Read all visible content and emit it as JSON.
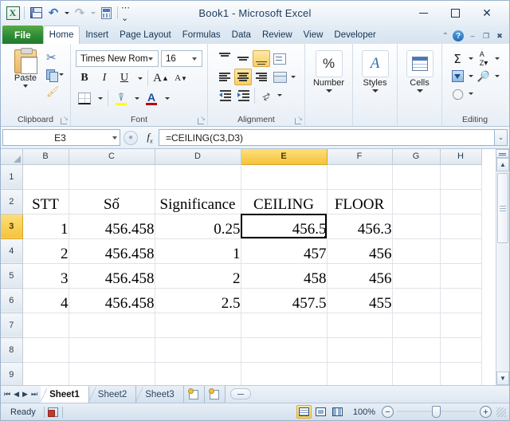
{
  "window": {
    "title": "Book1  -  Microsoft Excel",
    "minimize_label": "–",
    "maximize_label": "□",
    "close_label": "✕"
  },
  "quick_access": {
    "logo_label": "X",
    "items": [
      {
        "name": "save",
        "label": "Save"
      },
      {
        "name": "undo",
        "label": "Undo",
        "glyph": "↶"
      },
      {
        "name": "redo",
        "label": "Redo",
        "glyph": "↷"
      },
      {
        "name": "calculator",
        "label": "Calculator"
      },
      {
        "name": "customize",
        "label": "Customize Quick Access Toolbar",
        "glyph": "⌵"
      }
    ]
  },
  "ribbon": {
    "file_tab": "File",
    "tabs": [
      {
        "label": "Home",
        "active": true
      },
      {
        "label": "Insert",
        "active": false
      },
      {
        "label": "Page Layout",
        "active": false
      },
      {
        "label": "Formulas",
        "active": false
      },
      {
        "label": "Data",
        "active": false
      },
      {
        "label": "Review",
        "active": false
      },
      {
        "label": "View",
        "active": false
      },
      {
        "label": "Developer",
        "active": false
      }
    ],
    "collapse_glyph": "⌃",
    "help_label": "?",
    "restore_glyphs": [
      "–",
      "❐",
      "✖"
    ],
    "groups": {
      "clipboard": {
        "label": "Clipboard",
        "paste_label": "Paste",
        "cut_label": "Cut",
        "copy_label": "Copy",
        "format_painter_label": "Format Painter"
      },
      "font": {
        "label": "Font",
        "font_name": "Times New Rom",
        "font_size": "16",
        "bold_label": "B",
        "italic_label": "I",
        "underline_label": "U",
        "grow_label": "A",
        "shrink_label": "A",
        "borders_label": "Borders",
        "fill_color_label": "Fill Color",
        "font_color_label": "A",
        "fill_color": "#ffff00",
        "font_color": "#c00000"
      },
      "alignment": {
        "label": "Alignment",
        "top_align_label": "Top Align",
        "middle_align_label": "Middle Align",
        "bottom_align_label": "Bottom Align",
        "align_left_label": "Align Text Left",
        "center_label": "Center",
        "align_right_label": "Align Text Right",
        "wrap_text_label": "Wrap Text",
        "merge_label": "Merge & Center",
        "decrease_indent_label": "Decrease Indent",
        "increase_indent_label": "Increase Indent",
        "orientation_label": "Orientation",
        "active_buttons": [
          "Bottom Align",
          "Center"
        ]
      },
      "number": {
        "label": "Number",
        "button_label": "%"
      },
      "styles": {
        "label": "Styles",
        "button_label": "A"
      },
      "cells": {
        "label": "Cells"
      },
      "editing": {
        "label": "Editing",
        "autosum_label": "Σ",
        "sort_filter_label": "Sort & Filter",
        "fill_label": "Fill",
        "find_label": "Find & Select",
        "clear_label": "Clear"
      }
    }
  },
  "formula_bar": {
    "name_box_value": "E3",
    "fx_label": "fx",
    "formula": "=CEILING(C3,D3)",
    "expand_glyph": "⌄"
  },
  "grid": {
    "columns": [
      "B",
      "C",
      "D",
      "E",
      "F",
      "G",
      "H"
    ],
    "selected_column": "E",
    "rows": [
      "1",
      "2",
      "3",
      "4",
      "5",
      "6",
      "7",
      "8",
      "9"
    ],
    "selected_row": "3",
    "active_cell": "E3",
    "data": [
      {
        "row": "1",
        "cells": [
          "",
          "",
          "",
          "",
          "",
          "",
          ""
        ]
      },
      {
        "row": "2",
        "cells": [
          "STT",
          "Số",
          "Significance",
          "CEILING",
          "FLOOR",
          "",
          ""
        ]
      },
      {
        "row": "3",
        "cells": [
          "1",
          "456.458",
          "0.25",
          "456.5",
          "456.3",
          "",
          ""
        ]
      },
      {
        "row": "4",
        "cells": [
          "2",
          "456.458",
          "1",
          "457",
          "456",
          "",
          ""
        ]
      },
      {
        "row": "5",
        "cells": [
          "3",
          "456.458",
          "2",
          "458",
          "456",
          "",
          ""
        ]
      },
      {
        "row": "6",
        "cells": [
          "4",
          "456.458",
          "2.5",
          "457.5",
          "455",
          "",
          ""
        ]
      },
      {
        "row": "7",
        "cells": [
          "",
          "",
          "",
          "",
          "",
          "",
          ""
        ]
      },
      {
        "row": "8",
        "cells": [
          "",
          "",
          "",
          "",
          "",
          "",
          ""
        ]
      },
      {
        "row": "9",
        "cells": [
          "",
          "",
          "",
          "",
          "",
          "",
          ""
        ]
      }
    ]
  },
  "sheet_tabs": {
    "nav_first": "⏮",
    "nav_prev": "◀",
    "nav_next": "▶",
    "nav_last": "⏭",
    "tabs": [
      {
        "label": "Sheet1",
        "active": true
      },
      {
        "label": "Sheet2",
        "active": false
      },
      {
        "label": "Sheet3",
        "active": false
      }
    ],
    "insert_sheet_label": "Insert Worksheet"
  },
  "status_bar": {
    "status": "Ready",
    "macro_label": "Record Macro",
    "view_normal_label": "Normal",
    "view_layout_label": "Page Layout",
    "view_break_label": "Page Break Preview",
    "zoom": "100%",
    "zoom_out_label": "−",
    "zoom_in_label": "+"
  },
  "scrollbar": {
    "up_glyph": "▲",
    "down_glyph": "▼"
  }
}
